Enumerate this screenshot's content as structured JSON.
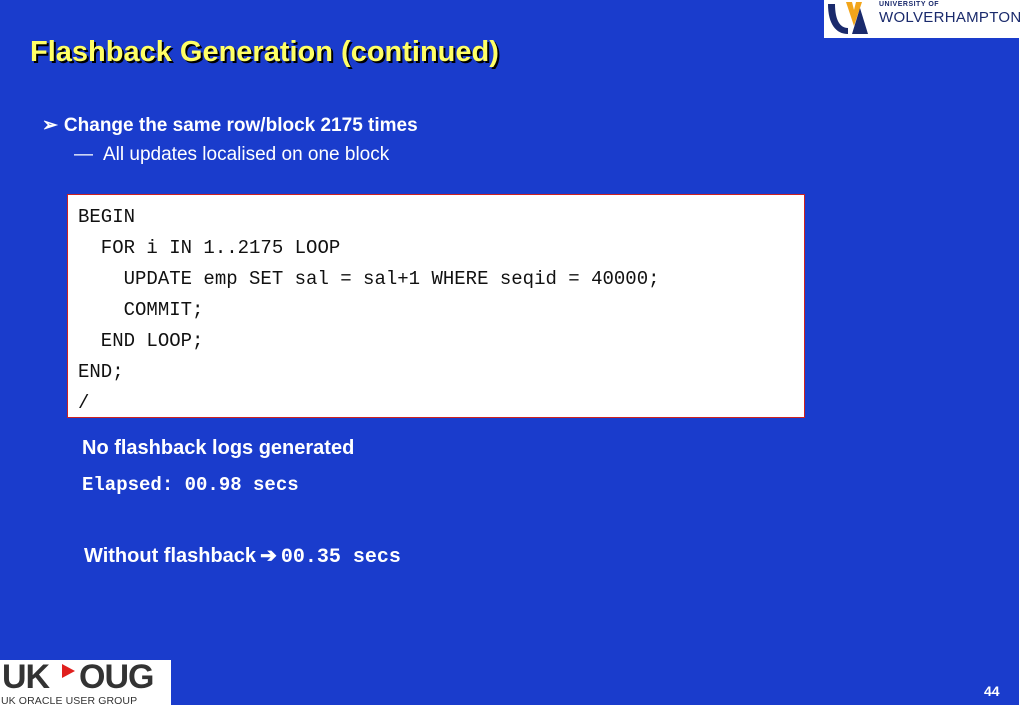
{
  "slide": {
    "title": "Flashback Generation (continued)",
    "bullet_main": "Change the same row/block 2175 times",
    "bullet_sub": "All updates localised on one block",
    "code_lines": [
      "BEGIN",
      "  FOR i IN 1..2175 LOOP",
      "    UPDATE emp SET sal = sal+1 WHERE seqid = 40000;",
      "    COMMIT;",
      "  END LOOP;",
      "END;",
      "/"
    ],
    "result_text": "No flashback logs generated",
    "elapsed_text": "Elapsed: 00.98 secs",
    "without_label": "Without flashback",
    "without_value": "00.35 secs",
    "page_number": "44"
  },
  "logos": {
    "university_small": "UNIVERSITY OF",
    "university_big": "WOLVERHAMPTON",
    "ukoug_uk": "UK",
    "ukoug_oug": "OUG",
    "ukoug_sub": "UK ORACLE USER GROUP"
  },
  "colors": {
    "background": "#1a3ccc",
    "title": "#ffff66",
    "code_border": "#cc2222",
    "ukoug_arrow": "#e0201e"
  },
  "icons": {
    "bullet": "arrowhead-bullet-icon",
    "sub_bullet": "em-dash-icon",
    "arrow": "right-arrow-icon"
  }
}
